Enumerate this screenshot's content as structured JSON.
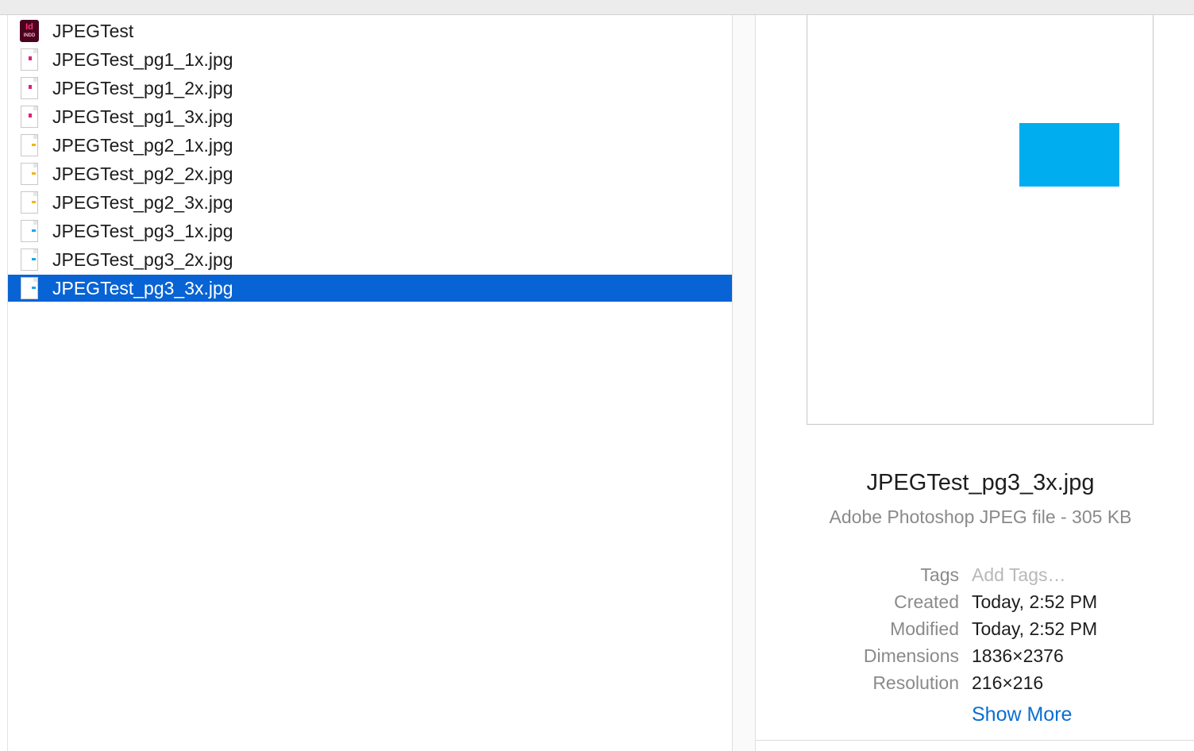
{
  "file_list": {
    "items": [
      {
        "name": "JPEGTest",
        "icon": "indesign-document-icon",
        "icon_text": "Id",
        "icon_subtext": "INDD",
        "mark_color": null,
        "selected": false
      },
      {
        "name": "JPEGTest_pg1_1x.jpg",
        "icon": "jpeg-file-icon",
        "mark_color": "#e0207a",
        "selected": false
      },
      {
        "name": "JPEGTest_pg1_2x.jpg",
        "icon": "jpeg-file-icon",
        "mark_color": "#e0207a",
        "selected": false
      },
      {
        "name": "JPEGTest_pg1_3x.jpg",
        "icon": "jpeg-file-icon",
        "mark_color": "#e0207a",
        "selected": false
      },
      {
        "name": "JPEGTest_pg2_1x.jpg",
        "icon": "jpeg-file-icon",
        "mark_color": "#f2b418",
        "selected": false
      },
      {
        "name": "JPEGTest_pg2_2x.jpg",
        "icon": "jpeg-file-icon",
        "mark_color": "#f2b418",
        "selected": false
      },
      {
        "name": "JPEGTest_pg2_3x.jpg",
        "icon": "jpeg-file-icon",
        "mark_color": "#f2b418",
        "selected": false
      },
      {
        "name": "JPEGTest_pg3_1x.jpg",
        "icon": "jpeg-file-icon",
        "mark_color": "#1aa7e6",
        "selected": false
      },
      {
        "name": "JPEGTest_pg3_2x.jpg",
        "icon": "jpeg-file-icon",
        "mark_color": "#1aa7e6",
        "selected": false
      },
      {
        "name": "JPEGTest_pg3_3x.jpg",
        "icon": "jpeg-file-icon",
        "mark_color": "#1aa7e6",
        "selected": true
      }
    ]
  },
  "preview": {
    "shape_color": "#00aeef",
    "title": "JPEGTest_pg3_3x.jpg",
    "subtitle": "Adobe Photoshop JPEG file - 305 KB",
    "meta": [
      {
        "label": "Tags",
        "value": "Add Tags…",
        "placeholder": true
      },
      {
        "label": "Created",
        "value": "Today, 2:52 PM",
        "placeholder": false
      },
      {
        "label": "Modified",
        "value": "Today, 2:52 PM",
        "placeholder": false
      },
      {
        "label": "Dimensions",
        "value": "1836×2376",
        "placeholder": false
      },
      {
        "label": "Resolution",
        "value": "216×216",
        "placeholder": false
      }
    ],
    "show_more_label": "Show More"
  },
  "colors": {
    "selection": "#0863d4",
    "link": "#0a6ed1"
  }
}
